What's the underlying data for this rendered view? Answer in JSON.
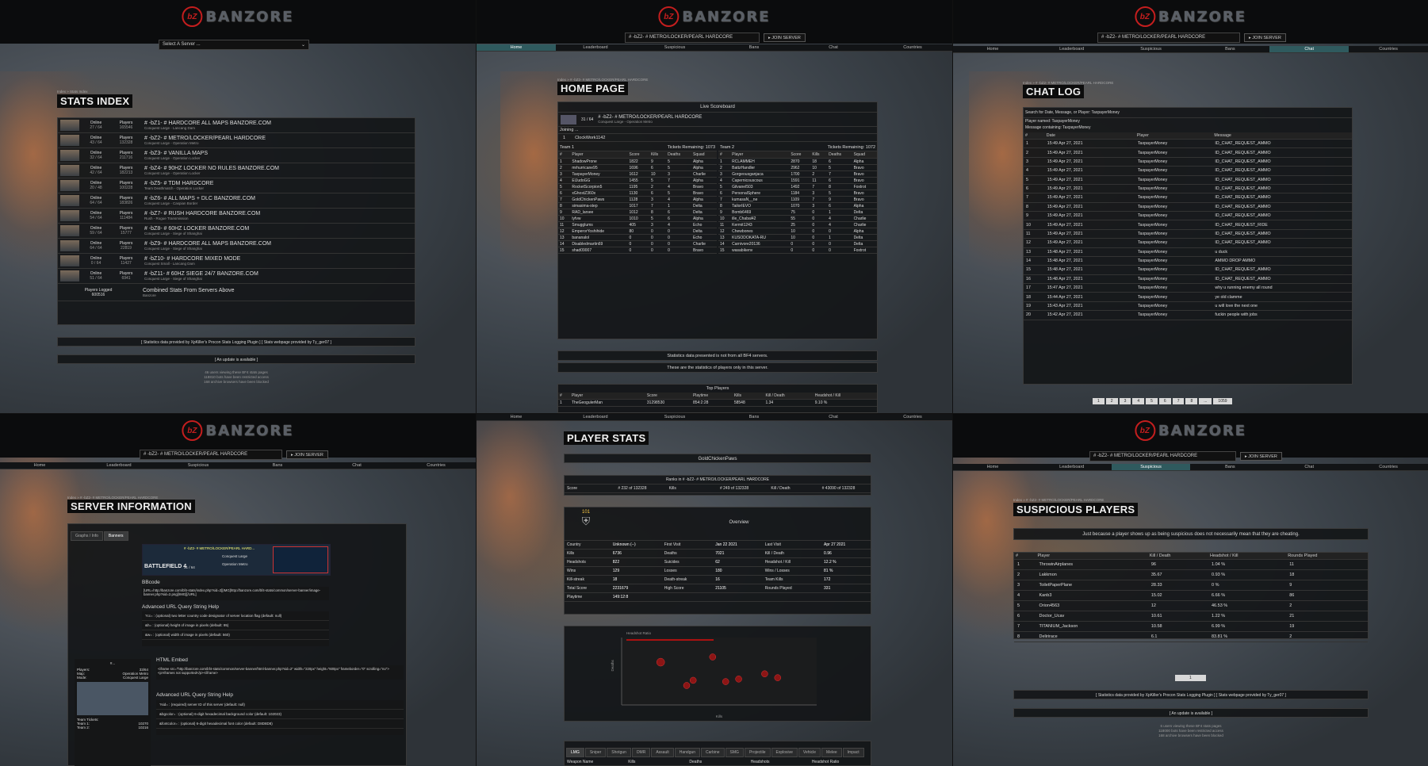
{
  "brand": {
    "logo_mark": "bZ",
    "logo_word": "BANZORE"
  },
  "common": {
    "server_select": "# -bZ2- # METRO/LOCKER/PEARL HARDCORE",
    "join_label": "▸ JOIN SERVER",
    "nav": [
      "Home",
      "Leaderboard",
      "Suspicious",
      "Bans",
      "Chat",
      "Countries"
    ],
    "footer_credit": "[ Statistics data provided by XpKiller's Procon Stats Logging Plugin ]   [ Stats webpage provided by Ty_ger07 ]",
    "footer_update": "[ An update is available ]"
  },
  "p1": {
    "select_placeholder": "Select A Server ...",
    "crumb": "Index » Stats Index",
    "title": "STATS INDEX",
    "servers": [
      {
        "online": "27 / 64",
        "players": "165546",
        "name": "# -bZ1- # HARDCORE ALL MAPS BANZORE.COM",
        "mode": "Conquest Large - Lancang Dam"
      },
      {
        "online": "43 / 64",
        "players": "132328",
        "name": "# -bZ2- # METRO/LOCKER/PEARL HARDCORE",
        "mode": "Conquest Large - Operation Metro"
      },
      {
        "online": "32 / 64",
        "players": "211716",
        "name": "# -bZ3- # VANILLA MAPS",
        "mode": "Conquest Large - Operation Locker"
      },
      {
        "online": "42 / 64",
        "players": "182213",
        "name": "# -bZ4- # 90HZ LOCKER NO RULES BANZORE.COM",
        "mode": "Conquest Large - Operation Locker"
      },
      {
        "online": "20 / 48",
        "players": "100228",
        "name": "# -bZ5- # TDM HARDCORE",
        "mode": "Team Deathmatch - Operation Locker"
      },
      {
        "online": "64 / 64",
        "players": "183826",
        "name": "# -bZ6- # ALL MAPS + DLC BANZORE.COM",
        "mode": "Conquest Large - Caspian Border"
      },
      {
        "online": "54 / 64",
        "players": "111484",
        "name": "# -bZ7- # RUSH HARDCORE BANZORE.COM",
        "mode": "Rush - Rogue Transmission"
      },
      {
        "online": "59 / 64",
        "players": "15777",
        "name": "# -bZ8- # 60HZ LOCKER BANZORE.COM",
        "mode": "Conquest Large - Siege of Shanghai"
      },
      {
        "online": "64 / 64",
        "players": "22819",
        "name": "# -bZ9- # HARDCORE ALL MAPS BANZORE.COM",
        "mode": "Conquest Large - Siege of Shanghai"
      },
      {
        "online": "0 / 64",
        "players": "11427",
        "name": "# -bZ10- # HARDCORE MIXED MODE",
        "mode": "Conquest Small - Lancang Dam"
      },
      {
        "online": "51 / 64",
        "players": "6941",
        "name": "# -bZ11- # 60HZ SIEGE 24/7 BANZORE.COM",
        "mode": "Conquest Large - Siege of Shanghai"
      }
    ],
    "online_label": "Online",
    "players_label": "Players",
    "logged_label": "Players Logged",
    "logged_value": "600516",
    "combined_title": "Combined Stats From Servers Above",
    "combined_sub": "Banzore",
    "bottom_notes": [
      "46 users viewing these BF4 stats pages",
      "118810 bots have been restricted access",
      "168 archive browsers have been blocked"
    ]
  },
  "p2": {
    "crumb": "Index » # -bZ2- # METRO/LOCKER/PEARL HARDCORE",
    "title": "HOME PAGE",
    "live": "Live Scoreboard",
    "server_line": "# -bZ2- # METRO/LOCKER/PEARL HARDCORE",
    "server_mode": "Conquest Large - Operation Metro",
    "server_players": "31 / 64",
    "joining": "Joining ...",
    "joiner": "ClockWork1142",
    "team1": "Team 1",
    "team1_tickets": "Tickets Remaining: 1073",
    "team2": "Team 2",
    "team2_tickets": "Tickets Remaining: 1072",
    "cols": [
      "#",
      "Player",
      "Score",
      "Kills",
      "Deaths",
      "Squad"
    ],
    "t1": [
      [
        "1",
        "ShadowProne",
        "1822",
        "9",
        "5",
        "Alpha"
      ],
      [
        "2",
        "mrhurricane95",
        "1696",
        "6",
        "5",
        "Alpha"
      ],
      [
        "3",
        "TaxpayerMoney",
        "1612",
        "10",
        "3",
        "Charlie"
      ],
      [
        "4",
        "ElJudoGG",
        "1455",
        "5",
        "7",
        "Alpha"
      ],
      [
        "5",
        "RocketScorpion5",
        "1195",
        "2",
        "4",
        "Bravo"
      ],
      [
        "6",
        "xGhostZ360x",
        "1130",
        "6",
        "5",
        "Bravo"
      ],
      [
        "7",
        "GoldChickenPaws",
        "1128",
        "3",
        "4",
        "Alpha"
      ],
      [
        "8",
        "simasima-step",
        "1017",
        "7",
        "1",
        "Delta"
      ],
      [
        "9",
        "RAD_larsee",
        "1012",
        "8",
        "6",
        "Delta"
      ],
      [
        "10",
        "lyfvw",
        "1010",
        "5",
        "6",
        "Alpha"
      ],
      [
        "11",
        "Smugglums",
        "405",
        "3",
        "4",
        "Echo"
      ],
      [
        "12",
        "EmperorYoshihide",
        "80",
        "0",
        "0",
        "Delta"
      ],
      [
        "13",
        "bananalol",
        "0",
        "0",
        "0",
        "Echo"
      ],
      [
        "14",
        "Disabledmartin69",
        "0",
        "0",
        "0",
        "Charlie"
      ],
      [
        "15",
        "shad09007",
        "0",
        "0",
        "0",
        "Bravo"
      ]
    ],
    "t2": [
      [
        "1",
        "RCLAMMEH",
        "2870",
        "18",
        "6",
        "Alpha"
      ],
      [
        "2",
        "BattzHandler",
        "2962",
        "10",
        "5",
        "Bravo"
      ],
      [
        "3",
        "Gorgeousganjaca",
        "1700",
        "2",
        "7",
        "Bravo"
      ],
      [
        "4",
        "Capernicouscous",
        "1591",
        "11",
        "6",
        "Bravo"
      ],
      [
        "5",
        "Gilvanel503",
        "1492",
        "7",
        "8",
        "Foxtrot"
      ],
      [
        "6",
        "PersonalSphere",
        "1184",
        "3",
        "5",
        "Bravo"
      ],
      [
        "7",
        "kumasaN__ne",
        "1109",
        "7",
        "9",
        "Bravo"
      ],
      [
        "8",
        "TailorIEVO",
        "1070",
        "3",
        "6",
        "Alpha"
      ],
      [
        "9",
        "Bomb6469",
        "75",
        "0",
        "1",
        "Delta"
      ],
      [
        "10",
        "ille_Chabal42",
        "55",
        "0",
        "4",
        "Charlie"
      ],
      [
        "11",
        "Kermit1243",
        "25",
        "0",
        "4",
        "Charlie"
      ],
      [
        "12",
        "Chewbones",
        "10",
        "0",
        "0",
        "Alpha"
      ],
      [
        "13",
        "KUSODOKATA-RU",
        "10",
        "0",
        "1",
        "Delta"
      ],
      [
        "14",
        "Carnivore20136",
        "0",
        "0",
        "0",
        "Delta"
      ],
      [
        "15",
        "wasabikenv",
        "0",
        "0",
        "0",
        "Foxtrot"
      ]
    ],
    "notice1": "Statistics data presented is not from all BF4 servers.",
    "notice2": "These are the statistics of players only in this server.",
    "top_players": "Top Players",
    "top_cols": [
      "#",
      "Player",
      "Score",
      "Playtime",
      "Kills",
      "Kill / Death",
      "Headshot / Kill"
    ],
    "top_first": [
      "1",
      "TheGeogulerMan",
      "31298530",
      "854:2:28",
      "58548",
      "1.34",
      "9.10 %"
    ]
  },
  "p3": {
    "crumb": "Index » # -bZ2- # METRO/LOCKER/PEARL HARDCORE",
    "title": "CHAT LOG",
    "search": "Search for Date, Message, or Player:  TaxpayerMoney",
    "named": "Player named: TaxpayerMoney",
    "containing": "Message containing: TaxpayerMoney",
    "cols": [
      "#",
      "Date",
      "Player",
      "Message"
    ],
    "rows": [
      [
        "1",
        "15:49 Apr 27, 2021",
        "TaxpayerMoney",
        "ID_CHAT_REQUEST_AMMO"
      ],
      [
        "2",
        "15:49 Apr 27, 2021",
        "TaxpayerMoney",
        "ID_CHAT_REQUEST_AMMO"
      ],
      [
        "3",
        "15:49 Apr 27, 2021",
        "TaxpayerMoney",
        "ID_CHAT_REQUEST_AMMO"
      ],
      [
        "4",
        "15:49 Apr 27, 2021",
        "TaxpayerMoney",
        "ID_CHAT_REQUEST_AMMO"
      ],
      [
        "5",
        "15:49 Apr 27, 2021",
        "TaxpayerMoney",
        "ID_CHAT_REQUEST_AMMO"
      ],
      [
        "6",
        "15:49 Apr 27, 2021",
        "TaxpayerMoney",
        "ID_CHAT_REQUEST_AMMO"
      ],
      [
        "7",
        "15:49 Apr 27, 2021",
        "TaxpayerMoney",
        "ID_CHAT_REQUEST_AMMO"
      ],
      [
        "8",
        "15:49 Apr 27, 2021",
        "TaxpayerMoney",
        "ID_CHAT_REQUEST_AMMO"
      ],
      [
        "9",
        "15:49 Apr 27, 2021",
        "TaxpayerMoney",
        "ID_CHAT_REQUEST_AMMO"
      ],
      [
        "10",
        "15:49 Apr 27, 2021",
        "TaxpayerMoney",
        "ID_CHAT_REQUEST_RIDE"
      ],
      [
        "11",
        "15:49 Apr 27, 2021",
        "TaxpayerMoney",
        "ID_CHAT_REQUEST_AMMO"
      ],
      [
        "12",
        "15:49 Apr 27, 2021",
        "TaxpayerMoney",
        "ID_CHAT_REQUEST_AMMO"
      ],
      [
        "13",
        "15:48 Apr 27, 2021",
        "TaxpayerMoney",
        "u duck"
      ],
      [
        "14",
        "15:48 Apr 27, 2021",
        "TaxpayerMoney",
        "AMMO DROP AMMO"
      ],
      [
        "15",
        "15:48 Apr 27, 2021",
        "TaxpayerMoney",
        "ID_CHAT_REQUEST_AMMO"
      ],
      [
        "16",
        "15:48 Apr 27, 2021",
        "TaxpayerMoney",
        "ID_CHAT_REQUEST_AMMO"
      ],
      [
        "17",
        "15:47 Apr 27, 2021",
        "TaxpayerMoney",
        "why u running enemy all round"
      ],
      [
        "18",
        "15:44 Apr 27, 2021",
        "TaxpayerMoney",
        "ye old clamme"
      ],
      [
        "19",
        "15:43 Apr 27, 2021",
        "TaxpayerMoney",
        "u will love the next one"
      ],
      [
        "20",
        "15:42 Apr 27, 2021",
        "TaxpayerMoney",
        "fuckin people with jobs"
      ]
    ],
    "pages": [
      "1",
      "2",
      "3",
      "4",
      "5",
      "6",
      "7",
      "8",
      "...",
      "1059"
    ]
  },
  "p4": {
    "crumb": "Index » # -bZ2- # METRO/LOCKER/PEARL HARDCORE",
    "title": "SERVER INFORMATION",
    "tabs": [
      "Graphs / Info",
      "Banners"
    ],
    "banner_server": "# -bZ2- # METRO/LOCKER/PEARL HARD...",
    "banner_mode": "Conquest Large",
    "banner_map": "Operation Metro",
    "banner_players": "31 / 64",
    "bbcode": "BBcode",
    "bbcode_text": "[URL=http://banzore.com/bf4-stats/index.php?sid=2][IMG]http://banzore.com/bf4-stats/common/server-banner/image-banner.php?sid=2.png[/IMG][/URL]",
    "adv": "Advanced URL Query String Help",
    "adv_lines": [
      "?cc= : (optional) two letter country code designator of server location flag (default: null)",
      "&h= : (optional) height of image in pixels (default: 95)",
      "&w= : (optional) width of image in pixels (default: 560)"
    ],
    "html_embed": "HTML Embed",
    "iframe_text": "<iframe src=\"http://banzore.com/bf4-stats/common/server-banner/html-banner.php?sid=2\" width=\"220px\" height=\"600px\" frameborder=\"0\" scrolling=\"no\"><p>iframes not supported</p></iframe>",
    "adv2_lines": [
      "?sid= : (required) server ID of this server (default: null)",
      "&bgcolor= : (optional) 6-digit hexadecimal background color (default: 102023)",
      "&fontcolor= : (optional) 6-digit hexadecimal font color (default: D8D8D8)"
    ],
    "side": {
      "players": "33/64",
      "map": "Operation Metro",
      "mode": "Conquest Large",
      "team1": "10270",
      "team2": "10216",
      "team_tickets": "Team Tickets:"
    }
  },
  "p5": {
    "title": "PLAYER STATS",
    "player": "GoldChickenPaws",
    "ranks_title": "Ranks in # -bZ2- # METRO/LOCKER/PEARL HARDCORE",
    "ranks": [
      "Score",
      "# 232 of 132328",
      "Kills",
      "# 249 of 132328",
      "Kill / Death",
      "# 43090 of 132328"
    ],
    "rank_num": "101",
    "overview": "Overview",
    "stats": [
      [
        "Country",
        "Unknown (--)",
        "First Visit",
        "Jan 22 2021",
        "Last Visit",
        "Apr 27 2021"
      ],
      [
        "Kills",
        "6736",
        "Deaths",
        "7021",
        "Kill / Death",
        "0.96"
      ],
      [
        "Headshots",
        "822",
        "Suicides",
        "62",
        "Headshot / Kill",
        "12.2 %"
      ],
      [
        "Wins",
        "129",
        "Losses",
        "180",
        "Wins / Losses",
        "81 %"
      ],
      [
        "Kill-streak",
        "18",
        "Death-streak",
        "16",
        "Team Kills",
        "172"
      ],
      [
        "Total Score",
        "2231679",
        "High Score",
        "21105",
        "Rounds Played",
        "331"
      ],
      [
        "Playtime",
        "149:12:8",
        "",
        "",
        "",
        ""
      ]
    ],
    "weap_tabs": [
      "LMG",
      "Sniper",
      "Shotgun",
      "DMR",
      "Assault",
      "Handgun",
      "Carbine",
      "SMG",
      "Projectile",
      "Explosive",
      "Vehicle",
      "Melee",
      "Impact"
    ],
    "weap_cols": [
      "Weapon Name",
      "Kills",
      "Deaths",
      "Headshots",
      "Headshot Ratio"
    ],
    "chart_title": "Headshot Ratio"
  },
  "p6": {
    "crumb": "Index » # -bZ2- # METRO/LOCKER/PEARL HARDCORE",
    "title": "SUSPICIOUS PLAYERS",
    "notice": "Just because a player shows up as being suspicious does not necessarily mean that they are cheating.",
    "cols": [
      "#",
      "Player",
      "Kill / Death",
      "Headshot / Kill",
      "Rounds Played"
    ],
    "rows": [
      [
        "1",
        "ThrowinAirplanes",
        "96",
        "1.04 %",
        "11"
      ],
      [
        "2",
        "Lakkmon",
        "35.67",
        "0.93 %",
        "18"
      ],
      [
        "3",
        "ToiletPaperPlane",
        "28.33",
        "0 %",
        "9"
      ],
      [
        "4",
        "Kanb3",
        "15.02",
        "6.66 %",
        "86"
      ],
      [
        "5",
        "Orion4563",
        "12",
        "46.53 %",
        "2"
      ],
      [
        "6",
        "Doctor_Ucav",
        "10.61",
        "1.22 %",
        "21"
      ],
      [
        "7",
        "TITANIUM_Jackson",
        "10.58",
        "6.99 %",
        "19"
      ],
      [
        "8",
        "Delirirace",
        "6.1",
        "83.81 %",
        "2"
      ]
    ],
    "page": "1",
    "bottom_notes": [
      "6 users viewing these BF4 stats pages",
      "118000 bots have been restricted access",
      "168 archive browsers have been blocked"
    ]
  },
  "chart_data": {
    "type": "scatter",
    "title": "Headshot Ratio",
    "xlabel": "Kills",
    "ylabel": "Deaths",
    "points": [
      [
        700,
        480
      ],
      [
        1100,
        520
      ],
      [
        900,
        300
      ],
      [
        950,
        340
      ],
      [
        1200,
        330
      ],
      [
        1300,
        350
      ],
      [
        1600,
        360
      ],
      [
        1500,
        390
      ]
    ]
  }
}
